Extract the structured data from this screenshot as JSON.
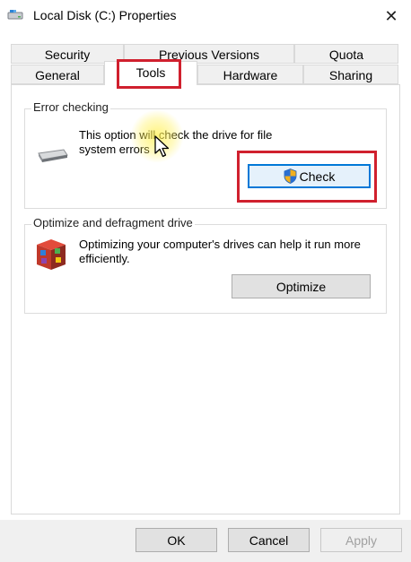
{
  "window": {
    "title": "Local Disk (C:) Properties",
    "close_glyph": "✕"
  },
  "tabs": {
    "row_back": [
      {
        "label": "Security"
      },
      {
        "label": "Previous Versions"
      },
      {
        "label": "Quota"
      }
    ],
    "row_front": [
      {
        "label": "General"
      },
      {
        "label": "Tools",
        "active": true
      },
      {
        "label": "Hardware"
      },
      {
        "label": "Sharing"
      }
    ]
  },
  "error_checking": {
    "group_label": "Error checking",
    "description": "This option will check the drive for file system errors",
    "check_label": "Check",
    "drive_icon": "drive-icon",
    "shield_icon": "uac-shield-icon"
  },
  "optimize": {
    "group_label": "Optimize and defragment drive",
    "description": "Optimizing your computer's drives can help it run more efficiently.",
    "optimize_label": "Optimize",
    "defrag_icon": "defrag-icon"
  },
  "footer": {
    "ok_label": "OK",
    "cancel_label": "Cancel",
    "apply_label": "Apply"
  },
  "colors": {
    "highlight": "#d0202e",
    "focus": "#0078d7"
  }
}
